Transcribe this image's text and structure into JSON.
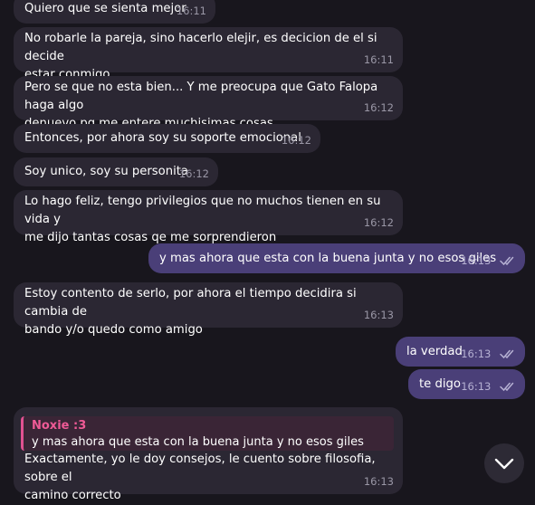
{
  "messages": [
    {
      "text": "Quiero que se sienta mejor",
      "time": "16:11"
    },
    {
      "text": "No robarle la pareja, sino hacerlo elejir, es decicion de el si decide\nestar conmigo",
      "time": "16:11"
    },
    {
      "text": "Pero se que no esta bien... Y me preocupa que Gato Falopa haga algo\ndenuevo pq me entere muchisimas cosas...",
      "time": "16:12"
    },
    {
      "text": "Entonces, por ahora soy su soporte emocional",
      "time": "16:12"
    },
    {
      "text": "Soy unico, soy su personita",
      "time": "16:12"
    },
    {
      "text": "Lo hago feliz, tengo privilegios que no muchos tienen en su vida y\nme dijo tantas cosas qe me sorprendieron",
      "time": "16:12"
    },
    {
      "text": "y mas ahora que esta con la buena junta y no esos giles",
      "time": "16:13"
    },
    {
      "text": "Estoy contento de serlo, por ahora el tiempo decidira si cambia de\nbando y/o quedo como amigo",
      "time": "16:13"
    },
    {
      "text": "la verdad",
      "time": "16:13"
    },
    {
      "text": "te digo",
      "time": "16:13"
    },
    {
      "text": "Exactamente, yo le doy consejos, le cuento sobre filosofia, sobre el\ncamino correcto",
      "time": "16:13",
      "reply": {
        "name": "Noxie :3",
        "text": "y mas ahora que esta con la buena junta y no esos giles"
      }
    }
  ],
  "icons": {
    "read_receipt": "double-check-icon",
    "scroll_down": "chevron-down-icon"
  },
  "colors": {
    "background": "#18161d",
    "incoming": "#2b2733",
    "outgoing": "#4a3f78",
    "reply_accent": "#e05191"
  }
}
